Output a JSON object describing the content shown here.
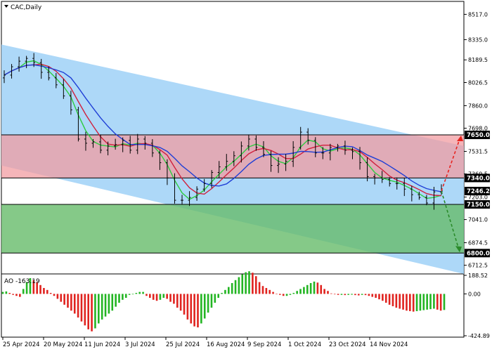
{
  "window": {
    "title": "CAC,Daily",
    "menu_icon": "triangle-down-icon"
  },
  "colors": {
    "channel": "#9fd1f7",
    "red_zone": "#f29ca2",
    "green_zone": "#66bb6a",
    "price_bars": "#000000",
    "ma_fast": "#2ecc40",
    "ma_mid": "#d0213e",
    "ma_slow": "#1f3fd6",
    "ao_up": "#23b523",
    "ao_down": "#e0231f",
    "arrow_up": "#e8231e",
    "arrow_down": "#2a8a2a",
    "label_bg": "#000000",
    "label_fg": "#ffffff"
  },
  "chart_data": [
    {
      "type": "candlestick",
      "symbol": "CAC",
      "timeframe": "Daily",
      "x_labels": [
        "25 Apr 2024",
        "20 May 2024",
        "11 Jun 2024",
        "3 Jul 2024",
        "25 Jul 2024",
        "16 Aug 2024",
        "9 Sep 2024",
        "1 Oct 2024",
        "23 Oct 2024",
        "14 Nov 2024"
      ],
      "y_ticks": [
        "8517.0",
        "8335.0",
        "8189.5",
        "8026.5",
        "7860.0",
        "7698.0",
        "7531.5",
        "7369.5",
        "7203.0",
        "7041.0",
        "6874.5",
        "6712.5"
      ],
      "ylim": [
        6650,
        8610
      ],
      "price_labels": [
        {
          "text": "7650.0",
          "value": 7650
        },
        {
          "text": "7340.0",
          "value": 7340
        },
        {
          "text": "7246.2",
          "value": 7246.2
        },
        {
          "text": "7150.0",
          "value": 7150
        },
        {
          "text": "6800.0",
          "value": 6800
        }
      ],
      "levels": {
        "resistance": 7650,
        "pivot": 7340,
        "current_price": 7246.2,
        "support": 7150,
        "target_low": 6800
      },
      "zones": [
        {
          "name": "sell zone",
          "from": 7340,
          "to": 7650
        },
        {
          "name": "buy zone",
          "from": 6800,
          "to": 7150
        }
      ],
      "channel": {
        "upper_start": 8300,
        "upper_end": 7570,
        "lower_start": 7430,
        "lower_end": 6650
      },
      "closes": [
        8080,
        8140,
        8180,
        8200,
        8170,
        8100,
        8060,
        8010,
        7930,
        7830,
        7620,
        7590,
        7600,
        7540,
        7570,
        7580,
        7610,
        7540,
        7620,
        7590,
        7520,
        7450,
        7340,
        7180,
        7180,
        7200,
        7260,
        7300,
        7380,
        7420,
        7460,
        7500,
        7570,
        7620,
        7560,
        7510,
        7430,
        7440,
        7460,
        7560,
        7670,
        7610,
        7520,
        7520,
        7560,
        7570,
        7540,
        7530,
        7450,
        7350,
        7340,
        7330,
        7300,
        7300,
        7260,
        7220,
        7200,
        7160,
        7240,
        7246.2
      ]
    },
    {
      "type": "bar",
      "name": "AO",
      "value_label": "-163.19",
      "y_ticks": [
        "188.52",
        "0.00",
        "-424.89"
      ],
      "ylim": [
        -424.89,
        188.52
      ],
      "values": [
        20,
        25,
        10,
        -10,
        -20,
        -30,
        50,
        120,
        160,
        140,
        120,
        90,
        60,
        40,
        10,
        -20,
        -50,
        -80,
        -110,
        -140,
        -170,
        -200,
        -240,
        -280,
        -320,
        -360,
        -380,
        -350,
        -300,
        -260,
        -230,
        -200,
        -170,
        -130,
        -90,
        -60,
        -40,
        -10,
        -5,
        10,
        20,
        20,
        -20,
        -40,
        -60,
        -70,
        -60,
        -40,
        -50,
        -80,
        -100,
        -140,
        -170,
        -210,
        -260,
        -300,
        -330,
        -340,
        -300,
        -250,
        -190,
        -140,
        -90,
        -40,
        10,
        40,
        70,
        110,
        140,
        170,
        200,
        220,
        230,
        215,
        180,
        120,
        80,
        60,
        40,
        20,
        0,
        -10,
        -20,
        -20,
        -10,
        10,
        30,
        50,
        70,
        90,
        110,
        125,
        115,
        90,
        50,
        30,
        5,
        -5,
        -10,
        -10,
        -12,
        -10,
        -8,
        -12,
        -15,
        -10,
        -12,
        -20,
        -30,
        -40,
        -55,
        -70,
        -90,
        -110,
        -125,
        -140,
        -150,
        -160,
        -170,
        -175,
        -180,
        -175,
        -170,
        -165,
        -160,
        -155,
        -150,
        -160,
        -170,
        -163.19
      ]
    }
  ]
}
